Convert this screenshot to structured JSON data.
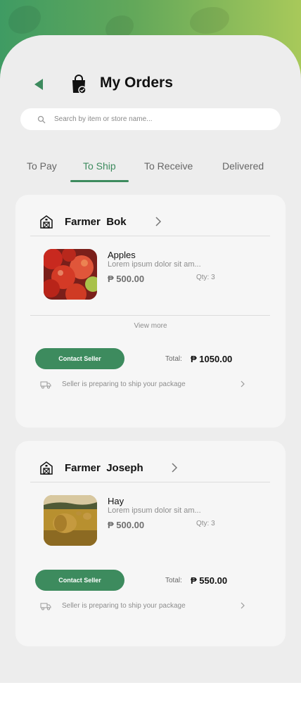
{
  "header": {
    "title": "My Orders"
  },
  "search": {
    "placeholder": "Search by item or store name..."
  },
  "tabs": [
    {
      "label": "To Pay",
      "active": false
    },
    {
      "label": "To Ship",
      "active": true
    },
    {
      "label": "To Receive",
      "active": false
    },
    {
      "label": "Delivered",
      "active": false
    }
  ],
  "orders": [
    {
      "store": "Farmer  Bok",
      "item": {
        "name": "Apples",
        "description": "Lorem ipsum dolor sit am...",
        "price": "₱ 500.00",
        "qty": "Qty: 3",
        "image": "apples-photo"
      },
      "view_more": "View more",
      "contact_label": "Contact Seller",
      "total_label": "Total:",
      "total_value": "₱ 1050.00",
      "status": "Seller is preparing to ship your package"
    },
    {
      "store": "Farmer  Joseph",
      "item": {
        "name": "Hay",
        "description": "Lorem ipsum dolor sit am...",
        "price": "₱ 500.00",
        "qty": "Qty: 3",
        "image": "hay-bales-photo"
      },
      "contact_label": "Contact Seller",
      "total_label": "Total:",
      "total_value": "₱ 550.00",
      "status": "Seller is preparing to ship your package"
    }
  ],
  "colors": {
    "accent": "#3d8b5e",
    "background": "#ededed",
    "card": "#f6f6f6"
  },
  "icons": [
    "back-arrow-icon",
    "shopping-bag-check-icon",
    "search-icon",
    "barn-icon",
    "chevron-right-icon",
    "truck-icon"
  ]
}
